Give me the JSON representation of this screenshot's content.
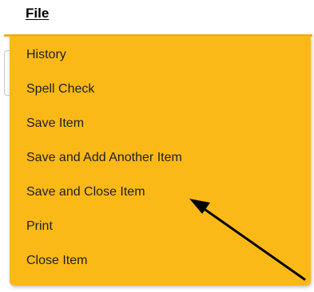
{
  "menu": {
    "title": "File",
    "accent_color": "#fbb918",
    "items": [
      {
        "label": "History"
      },
      {
        "label": "Spell Check"
      },
      {
        "label": "Save Item"
      },
      {
        "label": "Save and Add Another Item"
      },
      {
        "label": "Save and Close Item"
      },
      {
        "label": "Print"
      },
      {
        "label": "Close Item"
      }
    ]
  },
  "annotation": {
    "type": "arrow",
    "color": "#000000",
    "points_to": "Save and Close Item"
  }
}
